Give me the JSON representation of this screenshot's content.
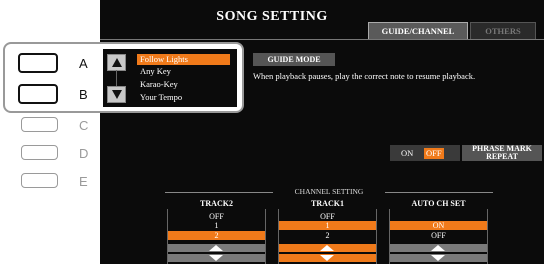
{
  "title": "SONG SETTING",
  "tabs": [
    "GUIDE/CHANNEL",
    "OTHERS"
  ],
  "guide_mode": {
    "label": "GUIDE MODE",
    "description": "When playback pauses, play the correct note to resume playback.",
    "options": [
      "Follow Lights",
      "Any Key",
      "Karao-Key",
      "Your Tempo"
    ],
    "selected": "Follow Lights"
  },
  "panel_buttons": [
    "A",
    "B",
    "C",
    "D",
    "E"
  ],
  "phrase_mark": {
    "on": "ON",
    "off": "OFF",
    "state": "OFF",
    "button_line1": "PHRASE MARK",
    "button_line2": "REPEAT"
  },
  "channel_setting": {
    "title": "CHANNEL SETTING",
    "columns": [
      {
        "name": "TRACK2",
        "values": [
          "OFF",
          "1",
          "2"
        ],
        "selected": "2"
      },
      {
        "name": "TRACK1",
        "values": [
          "OFF",
          "1",
          "2"
        ],
        "selected": "1"
      },
      {
        "name": "AUTO CH SET",
        "values": [
          "ON",
          "OFF"
        ],
        "selected": "ON"
      }
    ]
  },
  "colors": {
    "accent": "#f07a1a",
    "screen_bg": "#0b0b0b",
    "panel_gray": "#555555"
  }
}
